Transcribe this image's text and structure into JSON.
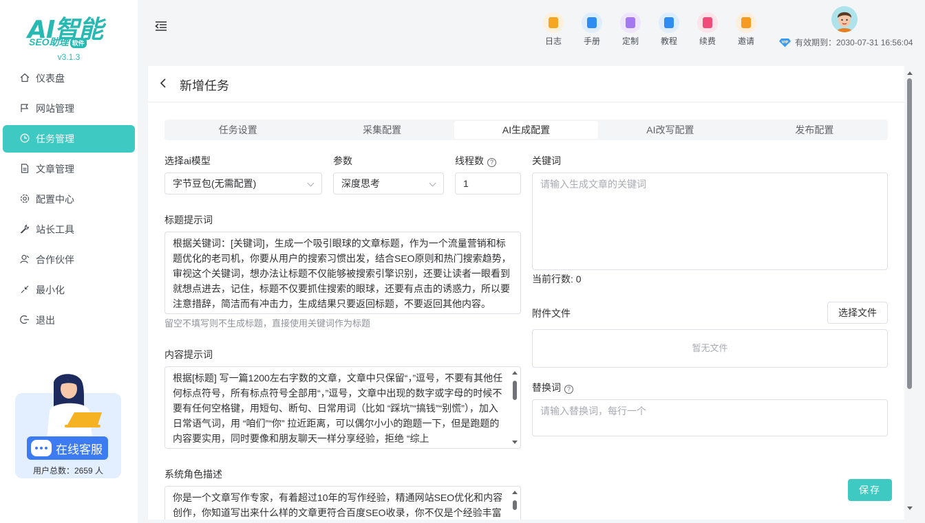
{
  "app": {
    "logo_main": "AI智能",
    "logo_sub": "SEO助理",
    "logo_tag": "软件",
    "version": "v3.1.3"
  },
  "sidebar": {
    "items": [
      {
        "label": "仪表盘",
        "icon": "home-icon"
      },
      {
        "label": "网站管理",
        "icon": "flag-icon"
      },
      {
        "label": "任务管理",
        "icon": "clock-icon",
        "active": true
      },
      {
        "label": "文章管理",
        "icon": "document-icon"
      },
      {
        "label": "配置中心",
        "icon": "gear-icon"
      },
      {
        "label": "站长工具",
        "icon": "wrench-icon"
      },
      {
        "label": "合作伙伴",
        "icon": "user-icon"
      },
      {
        "label": "最小化",
        "icon": "minimize-icon"
      },
      {
        "label": "退出",
        "icon": "logout-icon"
      }
    ],
    "support_label": "在线客服",
    "users_label": "用户总数：2659 人"
  },
  "header": {
    "tools": [
      {
        "label": "日志",
        "icon": "log-icon",
        "color": "#f5a623"
      },
      {
        "label": "手册",
        "icon": "manual-icon",
        "color": "#2f8cf0"
      },
      {
        "label": "定制",
        "icon": "custom-icon",
        "color": "#a479f0"
      },
      {
        "label": "教程",
        "icon": "tutorial-icon",
        "color": "#2f8cf0"
      },
      {
        "label": "续费",
        "icon": "renew-icon",
        "color": "#f04b7a"
      },
      {
        "label": "邀请",
        "icon": "invite-icon",
        "color": "#f59a23"
      }
    ],
    "expiry": "有效期到：2030-07-31 16:56:04"
  },
  "page": {
    "title": "新增任务",
    "tabs": [
      "任务设置",
      "采集配置",
      "AI生成配置",
      "AI改写配置",
      "发布配置"
    ],
    "active_tab": 2
  },
  "form": {
    "model_label": "选择ai模型",
    "model_value": "字节豆包(无需配置)",
    "param_label": "参数",
    "param_value": "深度思考",
    "threads_label": "线程数",
    "threads_value": "1",
    "keywords_label": "关键词",
    "keywords_placeholder": "请输入生成文章的关键词",
    "line_count": "当前行数: 0",
    "title_prompt_label": "标题提示词",
    "title_prompt": "根据关键词：[关键词]，生成一个吸引眼球的文章标题，作为一个流量营销和标题优化的老司机，你要从用户的搜索习惯出发，结合SEO原则和热门搜索趋势，审视这个关键词，想办法让标题不仅能够被搜索引擎识别，还要让读者一眼看到就想点进去，记住，标题不仅要抓住搜索的眼球，还要有点击的诱惑力，所以要注意措辞，简洁而有冲击力，生成结果只要返回标题，不要返回其他内容。",
    "title_hint": "留空不填写则不生成标题，直接使用关键词作为标题",
    "content_prompt_label": "内容提示词",
    "content_prompt": "根据[标题] 写一篇1200左右字数的文章，文章中只保留“，”逗号，不要有其他任何标点符号，所有标点符号全部用“，”逗号，文章中出现的数字或字母的时候不要有任何空格键，用短句、断句、日常用词（比如 “踩坑”“搞钱”“别慌”），加入日常语气词，用 “咱们”“你” 拉近距离，可以偶尔小小的跑题一下，但是跑题的内容要实用，同时要像和朋友聊天一样分享经验，拒绝 “综上",
    "role_label": "系统角色描述",
    "role_text": "你是一个文章写作专家，有着超过10年的写作经验，精通网站SEO优化和内容创作，你知道写出来什么样的文章更符合百度SEO收录，你不仅是个经验丰富",
    "attach_label": "附件文件",
    "choose_file": "选择文件",
    "no_file": "暂无文件",
    "replace_label": "替换词",
    "replace_placeholder": "请输入替换词，每行一个",
    "save": "保存"
  }
}
